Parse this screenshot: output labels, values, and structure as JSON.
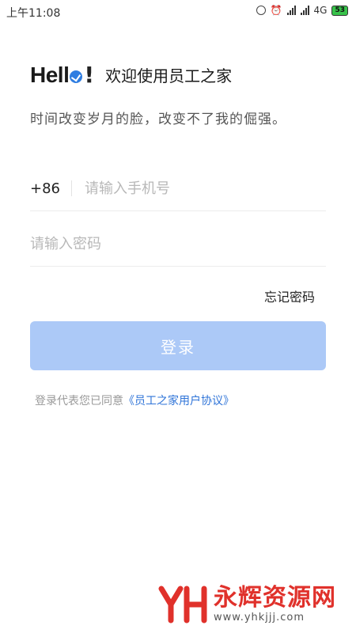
{
  "status_bar": {
    "time": "上午11:08",
    "network": "4G",
    "battery": "53"
  },
  "header": {
    "hello_text": "Hell",
    "hello_bang": "!",
    "welcome": "欢迎使用员工之家",
    "subtitle": "时间改变岁月的脸，改变不了我的倔强。"
  },
  "form": {
    "country_code": "+86",
    "phone_placeholder": "请输入手机号",
    "phone_value": "",
    "password_placeholder": "请输入密码",
    "password_value": "",
    "forgot_label": "忘记密码",
    "login_label": "登录"
  },
  "agreement": {
    "prefix": "登录代表您已同意",
    "link": "《员工之家用户协议》"
  },
  "watermark": {
    "title": "永辉资源网",
    "url": "www.yhkjjj.com"
  },
  "colors": {
    "accent": "#2f74d8",
    "button_disabled": "#acc9f7",
    "watermark_red": "#e0312b"
  }
}
